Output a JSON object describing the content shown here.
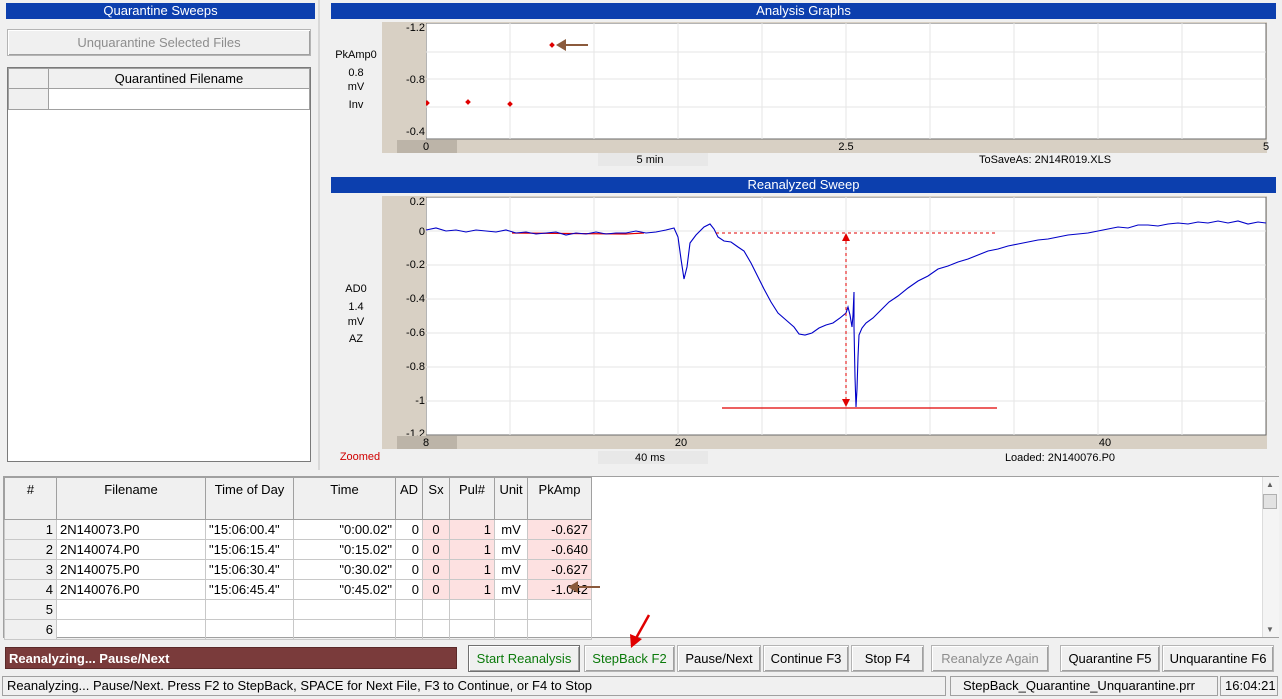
{
  "quarantine": {
    "title": "Quarantine Sweeps",
    "unquarantine_button": "Unquarantine Selected Files",
    "column_header": "Quarantined Filename"
  },
  "analysis": {
    "title": "Analysis Graphs",
    "y_name": "PkAmp0",
    "y_scale": "0.8",
    "y_unit": "mV",
    "y_mode": "Inv",
    "y_ticks": [
      "-1.2",
      "-0.8",
      "-0.4"
    ],
    "x_ticks": [
      "0",
      "2.5",
      "5"
    ],
    "x_scale": "5 min",
    "save_as": "ToSaveAs: 2N14R019.XLS"
  },
  "reanalyzed": {
    "title": "Reanalyzed Sweep",
    "channel": "AD0",
    "y_scale": "1.4",
    "y_unit": "mV",
    "y_mode": "AZ",
    "y_ticks": [
      "0.2",
      "0",
      "-0.2",
      "-0.4",
      "-0.6",
      "-0.8",
      "-1",
      "-1.2"
    ],
    "x_ticks": [
      "8",
      "20",
      "40"
    ],
    "x_scale": "40 ms",
    "zoom_state": "Zoomed",
    "loaded": "Loaded: 2N140076.P0"
  },
  "table": {
    "headers": [
      "#",
      "Filename",
      "Time of Day",
      "Time",
      "AD",
      "Sx",
      "Pul#",
      "Unit",
      "PkAmp"
    ],
    "rows": [
      {
        "n": "1",
        "file": "2N140073.P0",
        "tod": "\"15:06:00.4\"",
        "time": "\"0:00.02\"",
        "ad": "0",
        "sx": "0",
        "pul": "1",
        "unit": "mV",
        "pk": "-0.627"
      },
      {
        "n": "2",
        "file": "2N140074.P0",
        "tod": "\"15:06:15.4\"",
        "time": "\"0:15.02\"",
        "ad": "0",
        "sx": "0",
        "pul": "1",
        "unit": "mV",
        "pk": "-0.640"
      },
      {
        "n": "3",
        "file": "2N140075.P0",
        "tod": "\"15:06:30.4\"",
        "time": "\"0:30.02\"",
        "ad": "0",
        "sx": "0",
        "pul": "1",
        "unit": "mV",
        "pk": "-0.627"
      },
      {
        "n": "4",
        "file": "2N140076.P0",
        "tod": "\"15:06:45.4\"",
        "time": "\"0:45.02\"",
        "ad": "0",
        "sx": "0",
        "pul": "1",
        "unit": "mV",
        "pk": "-1.042"
      },
      {
        "n": "5",
        "file": "",
        "tod": "",
        "time": "",
        "ad": "",
        "sx": "",
        "pul": "",
        "unit": "",
        "pk": ""
      },
      {
        "n": "6",
        "file": "",
        "tod": "",
        "time": "",
        "ad": "",
        "sx": "",
        "pul": "",
        "unit": "",
        "pk": ""
      }
    ]
  },
  "status_panel": "Reanalyzing...   Pause/Next",
  "buttons": {
    "start": "Start Reanalysis",
    "stepback": "StepBack  F2",
    "pause": "Pause/Next",
    "continue": "Continue  F3",
    "stop": "Stop  F4",
    "again": "Reanalyze Again",
    "quarantine": "Quarantine  F5",
    "unquarantine": "Unquarantine  F6"
  },
  "statusbar": {
    "message": "Reanalyzing...  Pause/Next.  Press F2 to StepBack,  SPACE for Next File,  F3 to Continue,  or  F4 to Stop",
    "file": "StepBack_Quarantine_Unquarantine.prr",
    "clock": "16:04:21"
  },
  "colors": {
    "title_bar": "#0c3fae",
    "trace": "#0000c8",
    "marker": "#e00000",
    "annotation_arrow": "#8b5a3c",
    "status_panel": "#7a3b3b"
  }
}
